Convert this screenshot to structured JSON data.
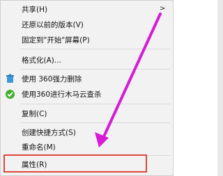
{
  "menu": {
    "items": [
      {
        "label": "共享(H)"
      },
      {
        "label": "还原以前的版本(V)"
      },
      {
        "label": "固定到\"开始\"屏幕(P)"
      },
      {
        "label": "格式化(A)..."
      },
      {
        "label": "使用 360强力删除"
      },
      {
        "label": "使用360进行木马云查杀"
      },
      {
        "label": "复制(C)"
      },
      {
        "label": "创建快捷方式(S)"
      },
      {
        "label": "重命名(M)"
      },
      {
        "label": "属性(R)"
      }
    ],
    "submenu_arrow": ">",
    "icons": {
      "delete": "360-delete-icon",
      "scan": "360-scan-icon"
    }
  },
  "colors": {
    "highlight": "#e0453c",
    "arrow": "#d51bd6"
  }
}
